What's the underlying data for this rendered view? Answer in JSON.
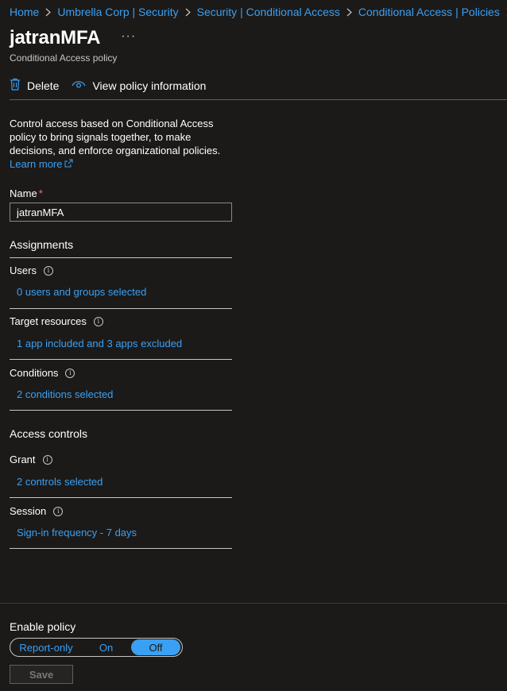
{
  "breadcrumb": [
    "Home",
    "Umbrella Corp | Security",
    "Security | Conditional Access",
    "Conditional Access | Policies"
  ],
  "page": {
    "title": "jatranMFA",
    "more_label": "···",
    "subtitle": "Conditional Access policy"
  },
  "toolbar": {
    "delete_label": "Delete",
    "view_info_label": "View policy information"
  },
  "intro": {
    "text": "Control access based on Conditional Access policy to bring signals together, to make decisions, and enforce organizational policies.",
    "learn_more": "Learn more"
  },
  "name": {
    "label": "Name",
    "required_mark": "*",
    "value": "jatranMFA"
  },
  "assignments": {
    "heading": "Assignments",
    "users": {
      "label": "Users",
      "value": "0 users and groups selected"
    },
    "target_resources": {
      "label": "Target resources",
      "value": "1 app included and 3 apps excluded"
    },
    "conditions": {
      "label": "Conditions",
      "value": "2 conditions selected"
    }
  },
  "access_controls": {
    "heading": "Access controls",
    "grant": {
      "label": "Grant",
      "value": "2 controls selected"
    },
    "session": {
      "label": "Session",
      "value": "Sign-in frequency - 7 days"
    }
  },
  "enable_policy": {
    "label": "Enable policy",
    "options": [
      "Report-only",
      "On",
      "Off"
    ],
    "selected": "Off"
  },
  "save_label": "Save",
  "info_glyph": "i",
  "colors": {
    "background": "#1b1a19",
    "link": "#3aa0f3",
    "text": "#ffffff",
    "required": "#f1707b"
  }
}
